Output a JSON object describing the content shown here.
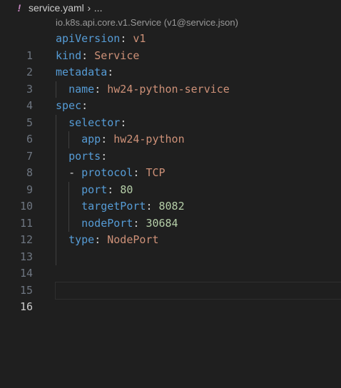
{
  "breadcrumb": {
    "icon": "exclamation-icon",
    "icon_glyph": "!",
    "file": "service.yaml",
    "separator": "›",
    "ellipsis": "..."
  },
  "codelens": "io.k8s.api.core.v1.Service (v1@service.json)",
  "lines": [
    {
      "num": "1",
      "key": "apiVersion",
      "value": "v1",
      "vtype": "s"
    },
    {
      "num": "2",
      "key": "kind",
      "value": "Service",
      "vtype": "s"
    },
    {
      "num": "3",
      "key": "metadata",
      "value": "",
      "vtype": "s"
    },
    {
      "num": "4",
      "key": "name",
      "value": "hw24-python-service",
      "vtype": "s"
    },
    {
      "num": "5",
      "key": "spec",
      "value": "",
      "vtype": "s"
    },
    {
      "num": "6",
      "key": "selector",
      "value": "",
      "vtype": "s"
    },
    {
      "num": "7",
      "key": "app",
      "value": "hw24-python",
      "vtype": "s"
    },
    {
      "num": "8",
      "key": "ports",
      "value": "",
      "vtype": "s"
    },
    {
      "num": "9",
      "dash": "- ",
      "key": "protocol",
      "value": "TCP",
      "vtype": "s"
    },
    {
      "num": "10",
      "key": "port",
      "value": "80",
      "vtype": "n"
    },
    {
      "num": "11",
      "key": "targetPort",
      "value": "8082",
      "vtype": "n"
    },
    {
      "num": "12",
      "key": "nodePort",
      "value": "30684",
      "vtype": "n"
    },
    {
      "num": "13",
      "key": "type",
      "value": "NodePort",
      "vtype": "s"
    },
    {
      "num": "14",
      "key": "",
      "value": ""
    },
    {
      "num": "15",
      "key": "",
      "value": ""
    },
    {
      "num": "16",
      "key": "",
      "value": ""
    }
  ],
  "colors": {
    "background": "#1f1f1f",
    "key": "#569cd6",
    "string": "#ce9178",
    "number": "#b5cea8",
    "line_number": "#6e7681",
    "line_number_active": "#cccccc"
  }
}
